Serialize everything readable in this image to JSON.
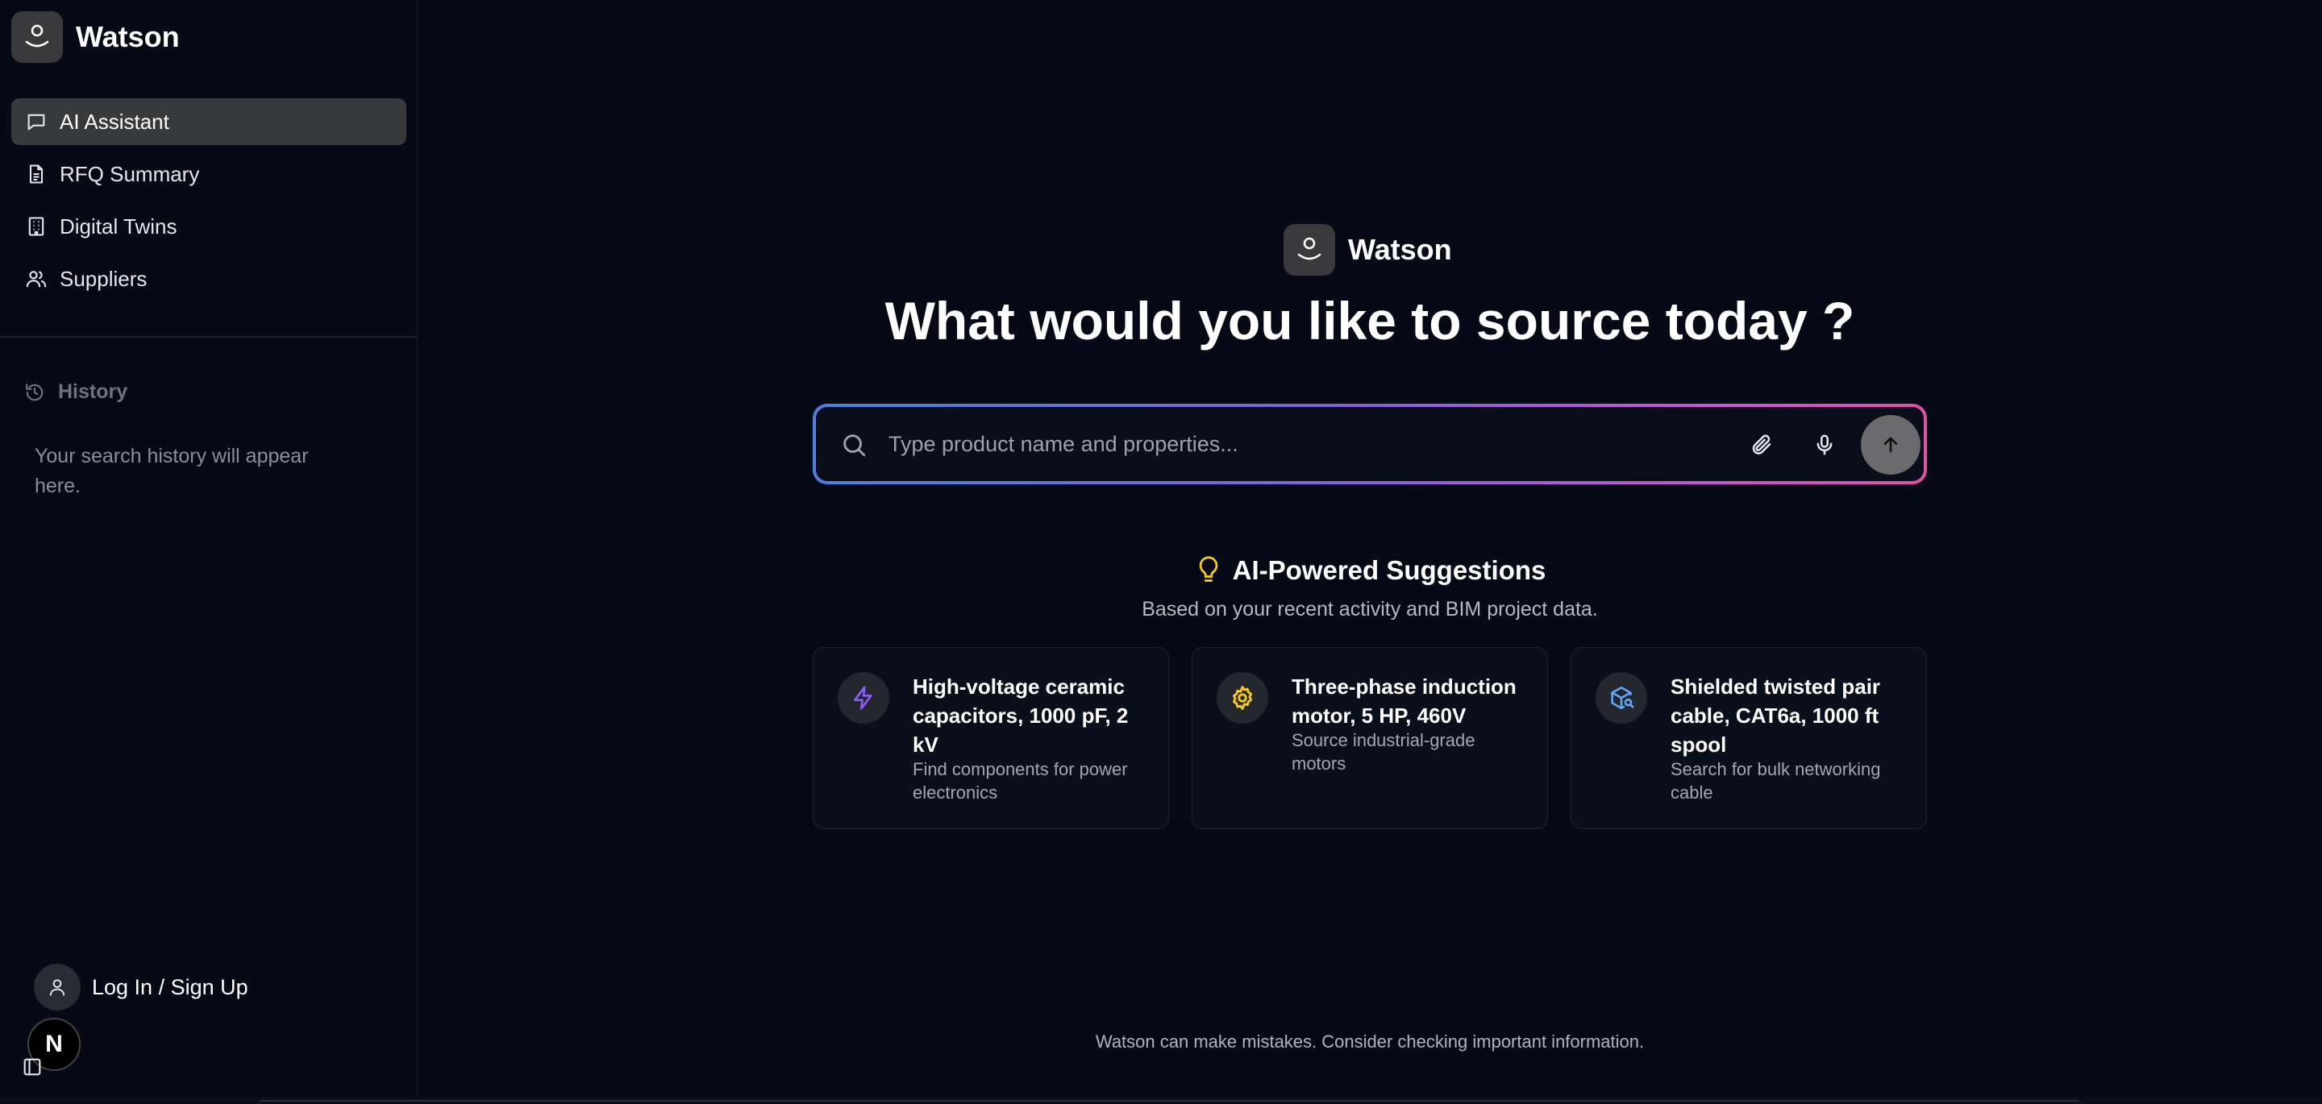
{
  "app": {
    "name": "Watson"
  },
  "sidebar": {
    "items": [
      {
        "label": "AI Assistant",
        "icon": "chat-icon",
        "active": true
      },
      {
        "label": "RFQ Summary",
        "icon": "document-icon",
        "active": false
      },
      {
        "label": "Digital Twins",
        "icon": "building-icon",
        "active": false
      },
      {
        "label": "Suppliers",
        "icon": "users-icon",
        "active": false
      }
    ],
    "history": {
      "title": "History",
      "empty_text": "Your search history will appear here."
    },
    "login_label": "Log In / Sign Up",
    "badge_letter": "N"
  },
  "main": {
    "brand": "Watson",
    "headline": "What would you like to source today ?",
    "search": {
      "placeholder": "Type product name and properties...",
      "value": ""
    },
    "suggestions": {
      "title": "AI-Powered Suggestions",
      "subtitle": "Based on your recent activity and BIM project data.",
      "cards": [
        {
          "title": "High-voltage ceramic capacitors, 1000 pF, 2 kV",
          "desc": "Find components for power electronics",
          "icon": "lightning-icon",
          "icon_color": "#8b5cf6"
        },
        {
          "title": "Three-phase induction motor, 5 HP, 460V",
          "desc": "Source industrial-grade motors",
          "icon": "gear-icon",
          "icon_color": "#facc15"
        },
        {
          "title": "Shielded twisted pair cable, CAT6a, 1000 ft spool",
          "desc": "Search for bulk networking cable",
          "icon": "package-search-icon",
          "icon_color": "#60a5fa"
        }
      ]
    },
    "disclaimer": "Watson can make mistakes. Consider checking important information."
  },
  "colors": {
    "background": "#060a16",
    "active_nav": "#38393b",
    "gradient_start": "#4f7fe0",
    "gradient_end": "#e24fa7",
    "bulb": "#facc15"
  }
}
